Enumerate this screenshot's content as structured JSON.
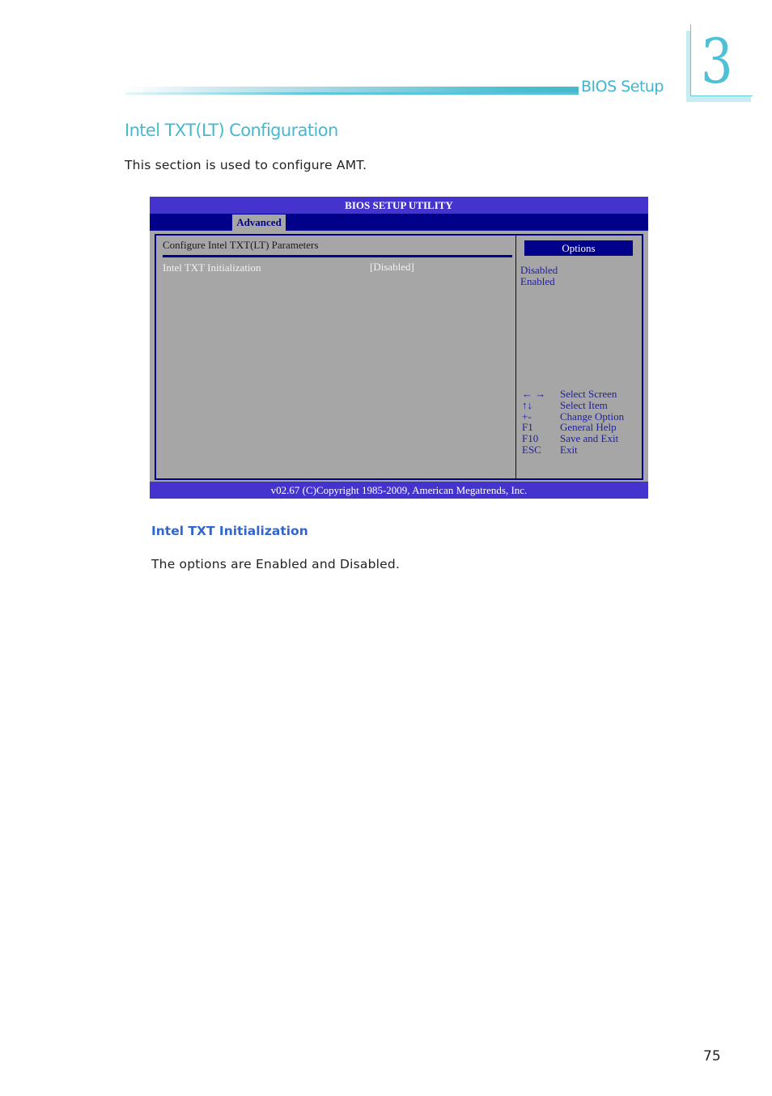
{
  "header": {
    "section_label": "BIOS Setup",
    "chapter_number": "3"
  },
  "section": {
    "title": "Intel TXT(LT) Configuration",
    "intro": "This section is used to configure AMT."
  },
  "bios": {
    "title": "BIOS SETUP UTILITY",
    "active_tab": "Advanced",
    "heading": "Configure Intel TXT(LT) Parameters",
    "items": [
      {
        "label": "Intel TXT Initialization",
        "value": "[Disabled]"
      }
    ],
    "options_header": "Options",
    "options": [
      "Disabled",
      "Enabled"
    ],
    "keys": [
      {
        "key": "← →",
        "action": "Select Screen"
      },
      {
        "key": "↑↓",
        "action": "Select Item"
      },
      {
        "key": "+-",
        "action": "Change Option"
      },
      {
        "key": "F1",
        "action": "General Help"
      },
      {
        "key": "F10",
        "action": "Save and Exit"
      },
      {
        "key": "ESC",
        "action": "Exit"
      }
    ],
    "footer": "v02.67 (C)Copyright 1985-2009, American Megatrends, Inc."
  },
  "subsection": {
    "title": "Intel TXT Initialization",
    "text": "The options are Enabled and Disabled."
  },
  "page_number": "75"
}
